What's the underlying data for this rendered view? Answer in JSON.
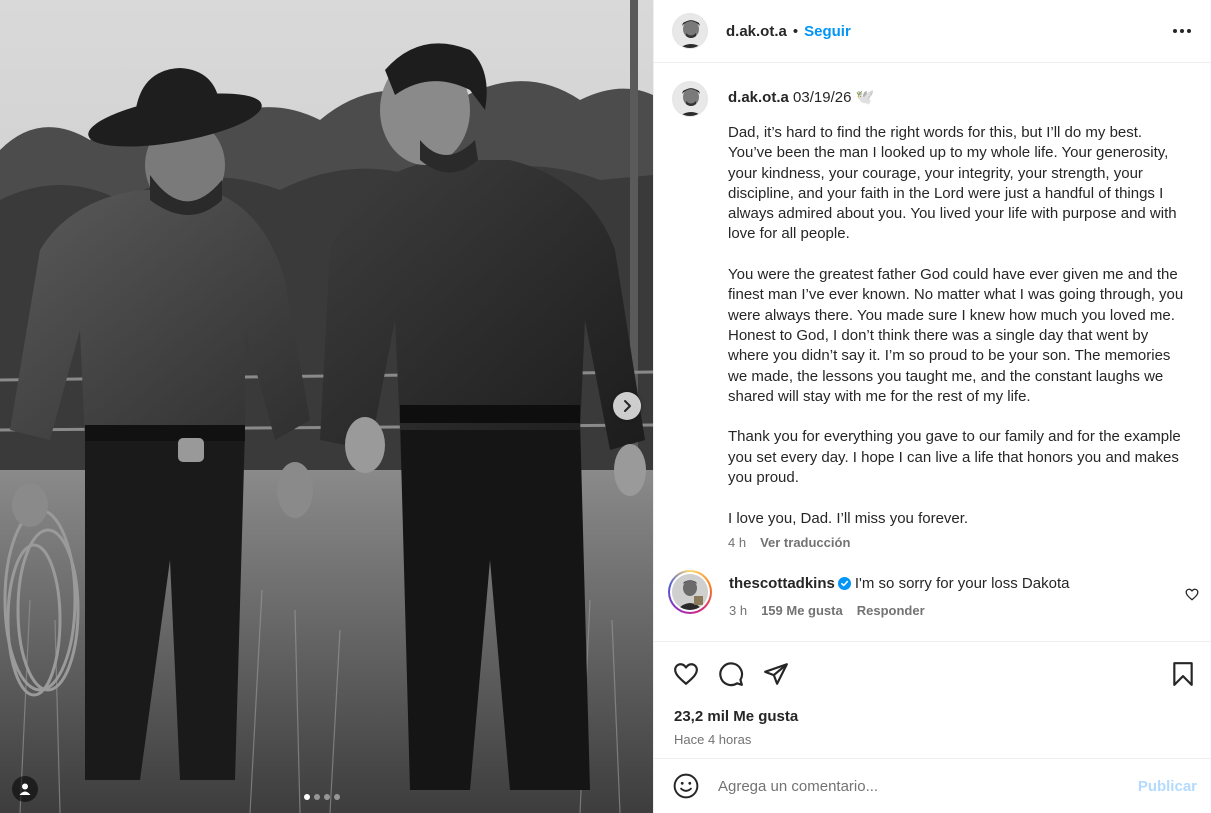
{
  "post": {
    "username": "d.ak.ot.a",
    "follow_label": "Seguir",
    "separator": "•",
    "image_alt": "Black and white photo of two men in denim shirts walking through tall grass, one wearing a cowboy hat and holding a rope",
    "carousel": {
      "count": 4,
      "active_index": 0
    }
  },
  "caption": {
    "username": "d.ak.ot.a",
    "date": "03/19/26",
    "emoji": "🕊️",
    "text": "Dad, it’s hard to find the right words for this, but I’ll do my best. You’ve been the man I looked up to my whole life. Your generosity, your kindness, your courage, your integrity, your strength, your discipline, and your faith in the Lord were just a handful of things I always admired about you. You lived your life with purpose and with love for all people.\n\nYou were the greatest father God could have ever given me and the finest man I’ve ever known. No matter what I was going through, you were always there. You made sure I knew how much you loved me. Honest to God, I don’t think there was a single day that went by where you didn’t say it. I’m so proud to be your son. The memories we made, the lessons you taught me, and the constant laughs we shared will stay with me for the rest of my life.\n\nThank you for everything you gave to our family and for the example you set every day. I hope I can live a life that honors you and makes you proud.\n\nI love you, Dad. I’ll miss you forever.",
    "time": "4 h",
    "translate_label": "Ver traducción"
  },
  "comments": [
    {
      "username": "thescottadkins",
      "verified": true,
      "text": "I'm so sorry for your loss Dakota",
      "time": "3 h",
      "likes": "159 Me gusta",
      "reply_label": "Responder"
    }
  ],
  "stats": {
    "likes": "23,2 mil Me gusta",
    "time_ago": "Hace 4 horas"
  },
  "comment_box": {
    "placeholder": "Agrega un comentario...",
    "post_label": "Publicar"
  },
  "colors": {
    "link_blue": "#0095f6",
    "post_disabled": "#b3dbff",
    "secondary_text": "#737373",
    "divider": "#efefef"
  },
  "icons": [
    "chevron-right-icon",
    "user-tag-icon",
    "more-options-icon",
    "heart-icon",
    "comment-icon",
    "share-icon",
    "bookmark-icon",
    "emoji-icon",
    "verified-badge-icon"
  ]
}
